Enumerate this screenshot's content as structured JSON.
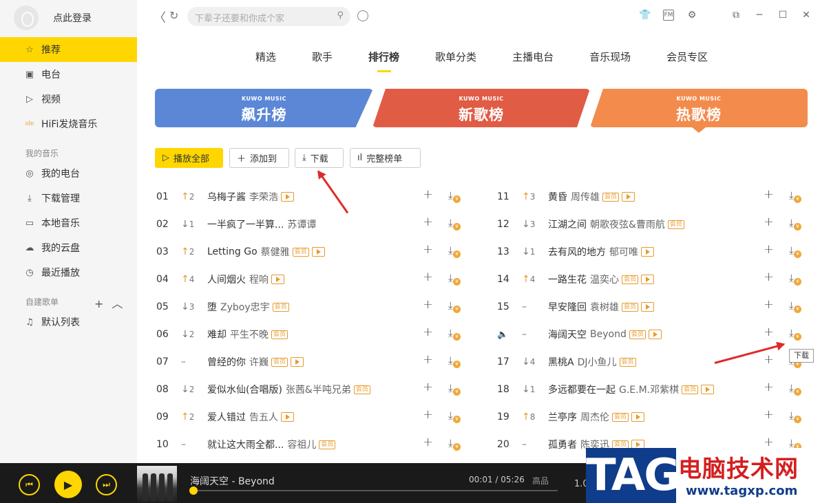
{
  "sidebar": {
    "login_text": "点此登录",
    "nav_top": [
      {
        "label": "推荐",
        "icon": "star-icon",
        "active": true
      },
      {
        "label": "电台",
        "icon": "radio-icon"
      },
      {
        "label": "视频",
        "icon": "video-icon"
      },
      {
        "label": "HiFi发烧音乐",
        "icon": "hifi-icon"
      }
    ],
    "my_music_title": "我的音乐",
    "nav_my": [
      {
        "label": "我的电台",
        "icon": "mic-icon"
      },
      {
        "label": "下载管理",
        "icon": "download-icon"
      },
      {
        "label": "本地音乐",
        "icon": "monitor-icon"
      },
      {
        "label": "我的云盘",
        "icon": "cloud-icon"
      },
      {
        "label": "最近播放",
        "icon": "clock-icon"
      }
    ],
    "playlist_title": "自建歌单",
    "playlists": [
      {
        "label": "默认列表",
        "icon": "playlist-icon"
      }
    ]
  },
  "topbar": {
    "search_placeholder": "下辈子还要和你成个家"
  },
  "tabs": [
    {
      "label": "精选"
    },
    {
      "label": "歌手"
    },
    {
      "label": "排行榜",
      "active": true
    },
    {
      "label": "歌单分类"
    },
    {
      "label": "主播电台"
    },
    {
      "label": "音乐现场"
    },
    {
      "label": "会员专区"
    }
  ],
  "banners": [
    {
      "logo": "KUWO MUSIC",
      "title": "飙升榜"
    },
    {
      "logo": "KUWO MUSIC",
      "title": "新歌榜"
    },
    {
      "logo": "KUWO MUSIC",
      "title": "热歌榜"
    }
  ],
  "actions": {
    "play_all": "播放全部",
    "add_to": "添加到",
    "download": "下载",
    "full_chart": "完整榜单"
  },
  "songs": [
    {
      "no": "01",
      "trend": "up",
      "change": "2",
      "title": "乌梅子酱",
      "artist": "李荣浩",
      "vip": false,
      "mv": true
    },
    {
      "no": "02",
      "trend": "down",
      "change": "1",
      "title": "一半疯了一半算...",
      "artist": "苏谭谭",
      "vip": false,
      "mv": false
    },
    {
      "no": "03",
      "trend": "up",
      "change": "2",
      "title": "Letting Go",
      "artist": "蔡健雅",
      "vip": true,
      "mv": true
    },
    {
      "no": "04",
      "trend": "up",
      "change": "4",
      "title": "人间烟火",
      "artist": "程响",
      "vip": false,
      "mv": true
    },
    {
      "no": "05",
      "trend": "down",
      "change": "3",
      "title": "堕",
      "artist": "Zyboy忠宇",
      "vip": true,
      "mv": false
    },
    {
      "no": "06",
      "trend": "down",
      "change": "2",
      "title": "难却",
      "artist": "平生不晚",
      "vip": true,
      "mv": false
    },
    {
      "no": "07",
      "trend": "same",
      "change": "",
      "title": "曾经的你",
      "artist": "许巍",
      "vip": true,
      "mv": true
    },
    {
      "no": "08",
      "trend": "down",
      "change": "2",
      "title": "爱似水仙(合唱版)",
      "artist": "张茜&半吨兄弟",
      "vip": true,
      "mv": false
    },
    {
      "no": "09",
      "trend": "up",
      "change": "2",
      "title": "爱人错过",
      "artist": "告五人",
      "vip": false,
      "mv": true
    },
    {
      "no": "10",
      "trend": "same",
      "change": "",
      "title": "就让这大雨全都...",
      "artist": "容祖儿",
      "vip": true,
      "mv": false
    },
    {
      "no": "11",
      "trend": "up",
      "change": "3",
      "title": "黄昏",
      "artist": "周传雄",
      "vip": true,
      "mv": true
    },
    {
      "no": "12",
      "trend": "down",
      "change": "3",
      "title": "江湖之间",
      "artist": "朝歌夜弦&曹雨航",
      "vip": true,
      "mv": false
    },
    {
      "no": "13",
      "trend": "down",
      "change": "1",
      "title": "去有风的地方",
      "artist": "郁可唯",
      "vip": false,
      "mv": true
    },
    {
      "no": "14",
      "trend": "up",
      "change": "4",
      "title": "一路生花",
      "artist": "温奕心",
      "vip": true,
      "mv": true
    },
    {
      "no": "15",
      "trend": "same",
      "change": "",
      "title": "早安隆回",
      "artist": "袁树雄",
      "vip": true,
      "mv": true
    },
    {
      "no": "",
      "trend": "same",
      "change": "",
      "title": "海阔天空",
      "artist": "Beyond",
      "vip": true,
      "mv": true,
      "playing": true
    },
    {
      "no": "17",
      "trend": "down",
      "change": "4",
      "title": "黑桃A",
      "artist": "DJ小鱼儿",
      "vip": true,
      "mv": false
    },
    {
      "no": "18",
      "trend": "down",
      "change": "1",
      "title": "多远都要在一起",
      "artist": "G.E.M.邓紫棋",
      "vip": true,
      "mv": true
    },
    {
      "no": "19",
      "trend": "up",
      "change": "8",
      "title": "兰亭序",
      "artist": "周杰伦",
      "vip": true,
      "mv": true
    },
    {
      "no": "20",
      "trend": "same",
      "change": "",
      "title": "孤勇者",
      "artist": "陈奕迅",
      "vip": true,
      "mv": true
    }
  ],
  "tags": {
    "vip": "会员",
    "same_mark": "–"
  },
  "tooltip": "下载",
  "player": {
    "song": "海阔天空 - Beyond",
    "time": "00:01 / 05:26",
    "quality": "高品",
    "speed": "1.0",
    "progress": 0.003
  },
  "watermark": {
    "tag": "TAG",
    "cn": "电脑技术网",
    "url": "www.tagxp.com"
  },
  "colors": {
    "accent": "#ffd600",
    "up": "#e79a2b",
    "annotation": "#e02a2a"
  }
}
